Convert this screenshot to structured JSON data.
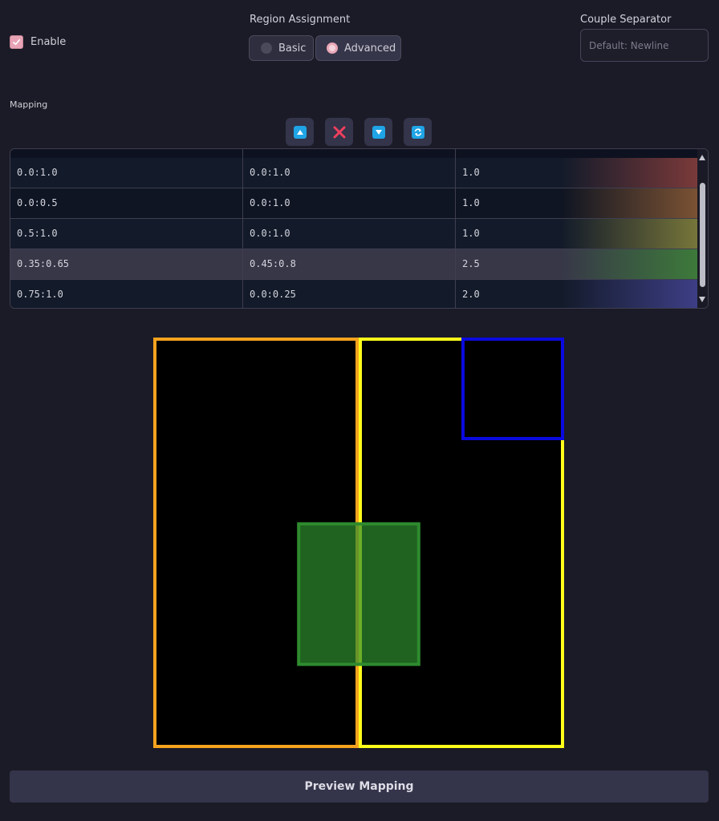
{
  "enable": {
    "label": "Enable",
    "checked": true
  },
  "region_assignment": {
    "label": "Region Assignment",
    "options": [
      {
        "label": "Basic",
        "selected": false
      },
      {
        "label": "Advanced",
        "selected": true
      }
    ]
  },
  "couple_separator": {
    "label": "Couple Separator",
    "placeholder": "Default: Newline",
    "value": ""
  },
  "mapping": {
    "label": "Mapping",
    "toolbar": [
      "move-up-icon",
      "delete-icon",
      "move-down-icon",
      "refresh-icon"
    ],
    "rows": [
      {
        "x": "0.0:1.0",
        "y": "0.0:1.0",
        "weight": "1.0",
        "color": "#7b3a3a"
      },
      {
        "x": "0.0:0.5",
        "y": "0.0:1.0",
        "weight": "1.0",
        "color": "#7b5233"
      },
      {
        "x": "0.5:1.0",
        "y": "0.0:1.0",
        "weight": "1.0",
        "color": "#77763a"
      },
      {
        "x": "0.35:0.65",
        "y": "0.45:0.8",
        "weight": "2.5",
        "color": "#3d7a3a"
      },
      {
        "x": "0.75:1.0",
        "y": "0.0:0.25",
        "weight": "2.0",
        "color": "#3d3e86"
      }
    ]
  },
  "preview": {
    "button_label": "Preview Mapping",
    "background": "#000000",
    "region_colors": [
      "#ff2020",
      "#f5a31e",
      "#ffff1a",
      "#2e8b2e",
      "#0a0ae0"
    ]
  }
}
